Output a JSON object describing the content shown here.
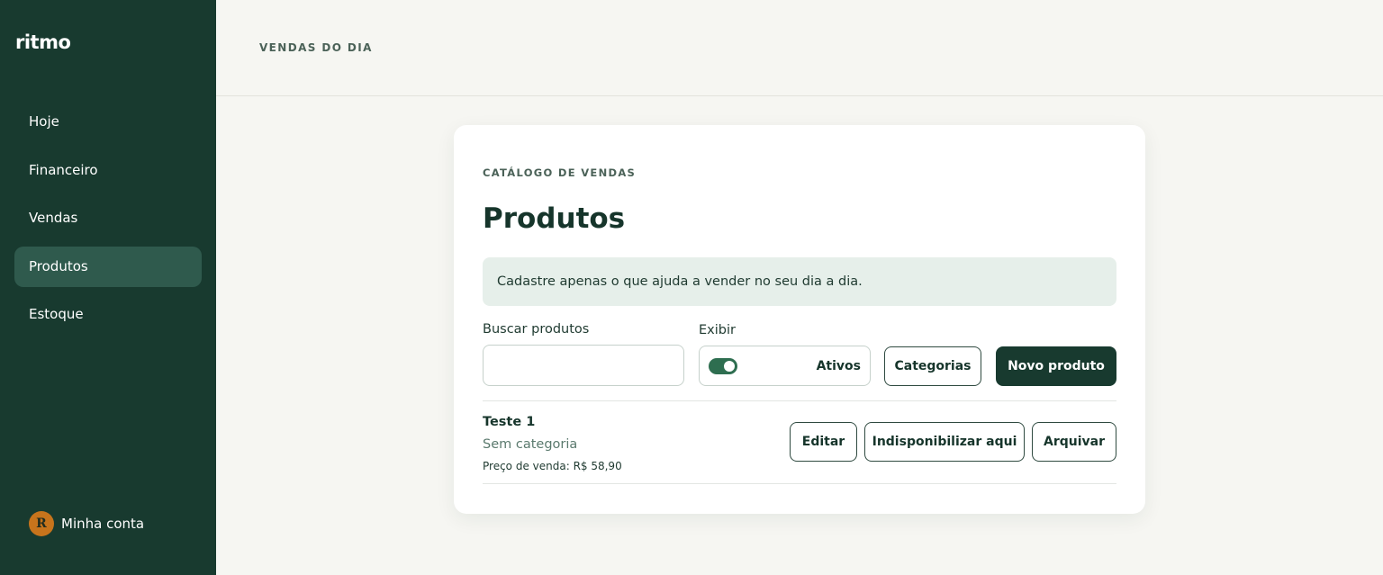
{
  "app": {
    "logo": "ritmo"
  },
  "sidebar": {
    "items": [
      {
        "label": "Hoje"
      },
      {
        "label": "Financeiro"
      },
      {
        "label": "Vendas"
      },
      {
        "label": "Produtos"
      },
      {
        "label": "Estoque"
      }
    ],
    "active": "Produtos",
    "account": {
      "initial": "R",
      "label": "Minha conta"
    }
  },
  "header": {
    "title": "VENDAS DO DIA"
  },
  "main": {
    "eyebrow": "CATÁLOGO DE VENDAS",
    "title": "Produtos",
    "hint": "Cadastre apenas o que ajuda a vender no seu dia a dia.",
    "search": {
      "label": "Buscar produtos",
      "value": "",
      "placeholder": ""
    },
    "filter": {
      "label": "Exibir",
      "toggle_on": true,
      "toggle_label": "Ativos"
    },
    "buttons": {
      "categories": "Categorias",
      "new_product": "Novo produto"
    },
    "products": [
      {
        "name": "Teste 1",
        "category": "Sem categoria",
        "price": "Preço de venda: R$ 58,90",
        "actions": {
          "edit": "Editar",
          "unavailable": "Indisponibilizar aqui",
          "archive": "Arquivar"
        }
      }
    ]
  },
  "colors": {
    "sidebar": "#183a2f",
    "sidebar_active": "#2f5a4d",
    "accent": "#2e6e50",
    "avatar": "#c7741c",
    "hint_bg": "#e6efea"
  }
}
